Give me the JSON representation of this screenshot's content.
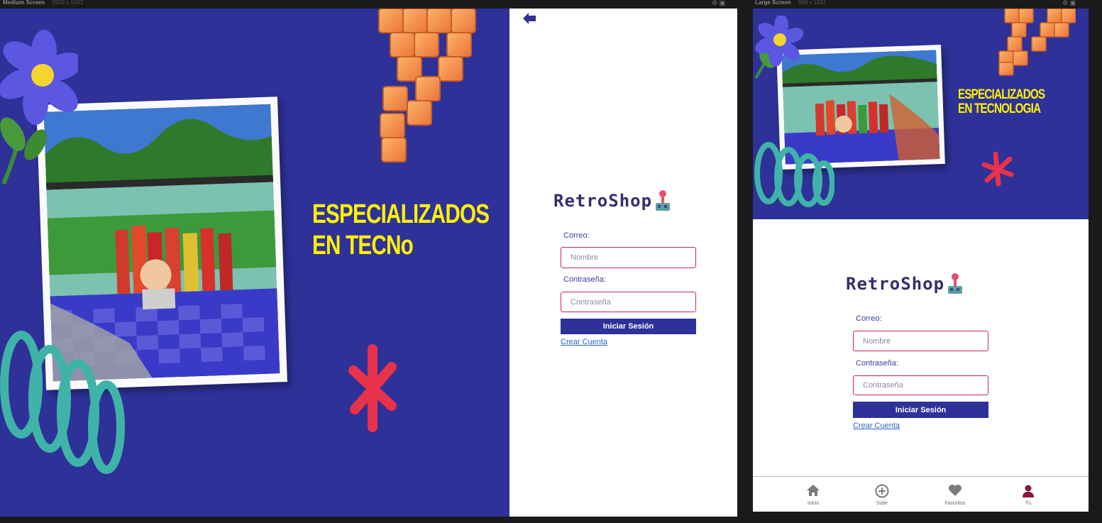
{
  "frames": {
    "medium": {
      "label": "Medium Screen",
      "size": "1509 x 1042"
    },
    "large": {
      "label": "Large Screen",
      "size": "668 x 1031"
    }
  },
  "hero": {
    "headline_medium_line1": "ESPECIALIZADOS",
    "headline_medium_line2": "EN TECNo",
    "headline_large_line1": "ESPECIALIZADOS",
    "headline_large_line2": "EN TECNOLOGIA"
  },
  "brand": {
    "name": "RetroShop"
  },
  "login": {
    "email_label": "Correo:",
    "email_placeholder": "Nombre",
    "password_label": "Contraseña:",
    "password_placeholder": "Contraseña",
    "submit_label": "Iniciar Sesión",
    "create_account_link": "Crear Cuenta"
  },
  "nav": {
    "items": [
      {
        "label": "Inicio",
        "icon": "home-icon"
      },
      {
        "label": "Subir",
        "icon": "plus-circle-icon"
      },
      {
        "label": "Favoritos",
        "icon": "heart-icon"
      },
      {
        "label": "Tú",
        "icon": "user-icon"
      }
    ]
  },
  "colors": {
    "hero_bg": "#2e3198",
    "headline": "#fff200",
    "input_border": "#c8206a",
    "button_bg": "#2e3198",
    "link": "#2a64c8",
    "active_nav": "#8a1540"
  }
}
